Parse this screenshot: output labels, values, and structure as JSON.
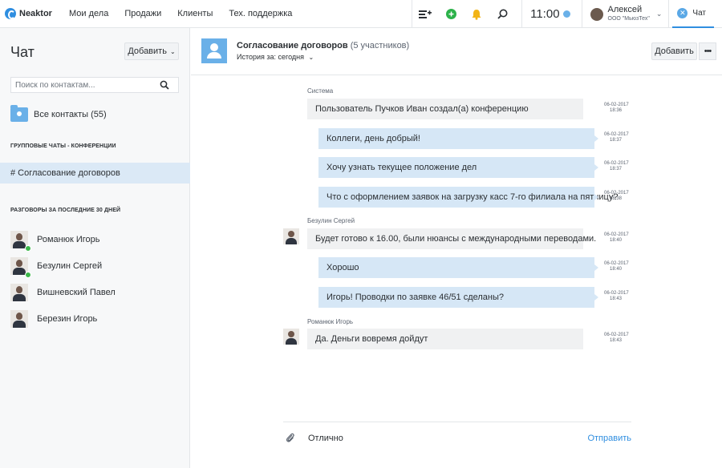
{
  "app": {
    "name": "Neaktor"
  },
  "nav": [
    "Мои дела",
    "Продажи",
    "Клиенты",
    "Тех. поддержка"
  ],
  "topbar": {
    "time": "11:00",
    "user_name": "Алексей",
    "user_org": "ООО \"МьюзТех\"",
    "chat_tab": "Чат",
    "colors": {
      "accent": "#2f8ee0",
      "green": "#2cb24a",
      "bell": "#f2b416"
    }
  },
  "sidebar": {
    "title": "Чат",
    "add_label": "Добавить",
    "search_placeholder": "Поиск по контактам...",
    "all_contacts": "Все контакты (55)",
    "group_section": "ГРУППОВЫЕ ЧАТЫ - КОНФЕРЕНЦИИ",
    "active_group": "# Согласование договоров",
    "recent_section": "РАЗГОВОРЫ ЗА ПОСЛЕДНИЕ 30 ДНЕЙ",
    "contacts": [
      {
        "name": "Романюк Игорь",
        "online": true
      },
      {
        "name": "Безулин Сергей",
        "online": true
      },
      {
        "name": "Вишневский Павел",
        "online": false
      },
      {
        "name": "Березин Игорь",
        "online": false
      }
    ]
  },
  "chat": {
    "title": "Согласование договоров",
    "participants": "(5 участников)",
    "history": "История за: сегодня",
    "add_label": "Добавить",
    "more_label": "•••",
    "senders": {
      "system": "Система",
      "bezulin": "Безулин Сергей",
      "romanyuk": "Романюк Игорь"
    },
    "messages": [
      {
        "text": "Пользователь Пучков Иван создал(а) конференцию",
        "date": "06-02-2017",
        "time": "18:36"
      },
      {
        "text": "Коллеги, день добрый!",
        "date": "06-02-2017",
        "time": "18:37"
      },
      {
        "text": "Хочу узнать текущее положение дел",
        "date": "06-02-2017",
        "time": "18:37"
      },
      {
        "text": "Что с оформлением заявок на загрузку касс 7-го филиала на пятницу?",
        "date": "06-02-2017",
        "time": "18:38"
      },
      {
        "text": "Будет готово к 16.00, были нюансы с международными переводами.",
        "date": "06-02-2017",
        "time": "18:40"
      },
      {
        "text": "Хорошо",
        "date": "06-02-2017",
        "time": "18:40"
      },
      {
        "text": "Игорь! Проводки по заявке 46/51 сделаны?",
        "date": "06-02-2017",
        "time": "18:43"
      },
      {
        "text": "Да. Деньги вовремя дойдут",
        "date": "06-02-2017",
        "time": "18:43"
      }
    ],
    "composer_text": "Отлично",
    "send_label": "Отправить"
  }
}
